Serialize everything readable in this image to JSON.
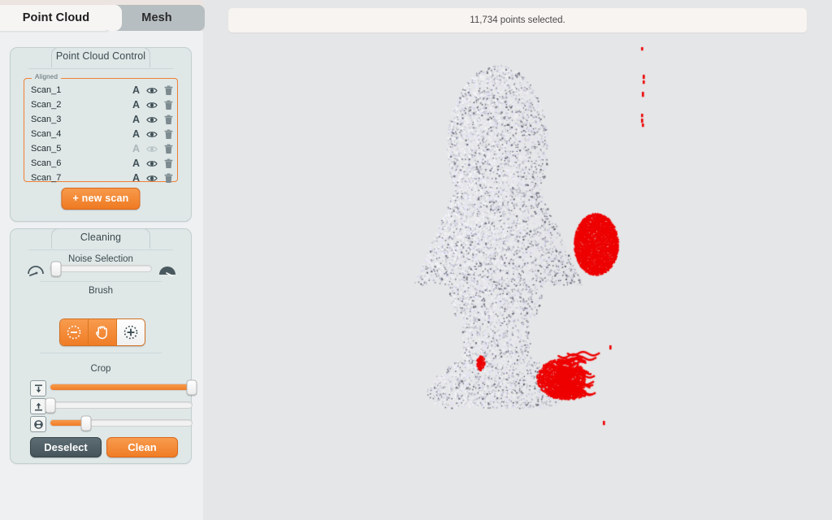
{
  "tabs": [
    {
      "label": "Point Cloud",
      "active": true
    },
    {
      "label": "Mesh",
      "active": false
    }
  ],
  "point_cloud_control": {
    "title": "Point Cloud Control",
    "group_legend": "Aligned",
    "scans": [
      {
        "name": "Scan_1",
        "visible": true,
        "annotated": true
      },
      {
        "name": "Scan_2",
        "visible": true,
        "annotated": true
      },
      {
        "name": "Scan_3",
        "visible": true,
        "annotated": true
      },
      {
        "name": "Scan_4",
        "visible": true,
        "annotated": true
      },
      {
        "name": "Scan_5",
        "visible": false,
        "annotated": false
      },
      {
        "name": "Scan_6",
        "visible": true,
        "annotated": true
      },
      {
        "name": "Scan_7",
        "visible": true,
        "annotated": true
      }
    ],
    "row_icons": [
      "text-a-icon",
      "eye-icon",
      "trash-icon"
    ],
    "new_scan_label": "+ new scan"
  },
  "cleaning": {
    "title": "Cleaning",
    "noise_selection_label": "Noise Selection",
    "noise_slider_value_pct": 6,
    "brush_label": "Brush",
    "brush_modes": [
      {
        "name": "brush-deselect",
        "selected": false
      },
      {
        "name": "brush-pan",
        "selected": false
      },
      {
        "name": "brush-select",
        "selected": true
      }
    ],
    "crop_label": "Crop",
    "crop_sliders": [
      {
        "icon": "crop-top-icon",
        "value_pct": 100
      },
      {
        "icon": "crop-bottom-icon",
        "value_pct": 0
      },
      {
        "icon": "crop-radial-icon",
        "value_pct": 25
      }
    ],
    "deselect_label": "Deselect",
    "clean_label": "Clean"
  },
  "viewport": {
    "status_text": "11,734 points selected.",
    "selection_color": "#ee0000",
    "background_color": "#e5e6e7",
    "model_name": "point-cloud-bust-statue"
  },
  "theme": {
    "accent": "#ef7d26",
    "panel_bg": "#dfe7e7",
    "sidebar_bg": "#eef0f1",
    "topstrip": "#ece4e0"
  }
}
